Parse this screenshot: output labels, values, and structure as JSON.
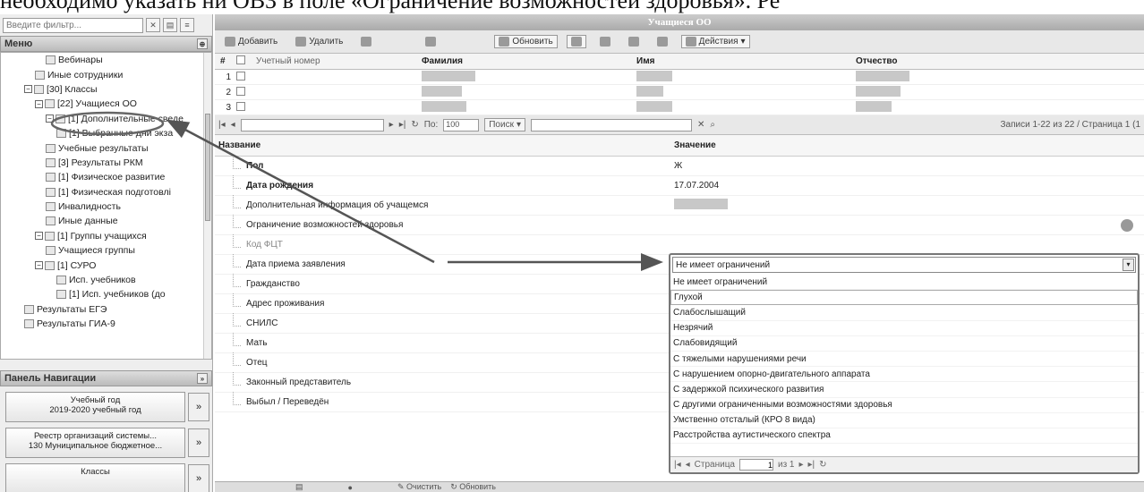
{
  "doc_text": "необходимо указать ни ОВЗ в поле «Ограничение возможностей здоровья». Ре",
  "left": {
    "filter_placeholder": "Введите фильтр...",
    "menu_title": "Меню",
    "tree_items": [
      {
        "label": "Вебинары",
        "indent": 4,
        "exp": ""
      },
      {
        "label": "Иные сотрудники",
        "indent": 3,
        "exp": ""
      },
      {
        "label": "[30] Классы",
        "indent": 2,
        "exp": "−"
      },
      {
        "label": "[22] Учащиеся ОО",
        "indent": 3,
        "exp": "−"
      },
      {
        "label": "[1] Дополнительные сведе",
        "indent": 4,
        "exp": "−"
      },
      {
        "label": "[1] Выбранные дни экза",
        "indent": 5,
        "exp": ""
      },
      {
        "label": "Учебные результаты",
        "indent": 4,
        "exp": ""
      },
      {
        "label": "[3] Результаты РКМ",
        "indent": 4,
        "exp": ""
      },
      {
        "label": "[1] Физическое развитие",
        "indent": 4,
        "exp": ""
      },
      {
        "label": "[1] Физическая подготовлі",
        "indent": 4,
        "exp": ""
      },
      {
        "label": "Инвалидность",
        "indent": 4,
        "exp": ""
      },
      {
        "label": "Иные данные",
        "indent": 4,
        "exp": ""
      },
      {
        "label": "[1] Группы учащихся",
        "indent": 3,
        "exp": "−"
      },
      {
        "label": "Учащиеся группы",
        "indent": 4,
        "exp": ""
      },
      {
        "label": "[1] СУРО",
        "indent": 3,
        "exp": "−"
      },
      {
        "label": "Исп. учебников",
        "indent": 5,
        "exp": ""
      },
      {
        "label": "[1] Исп. учебников (до",
        "indent": 5,
        "exp": ""
      },
      {
        "label": "Результаты ЕГЭ",
        "indent": 2,
        "exp": ""
      },
      {
        "label": "Результаты ГИА-9",
        "indent": 2,
        "exp": ""
      }
    ],
    "nav_title": "Панель Навигации",
    "nav_cards": [
      {
        "line1": "Учебный год",
        "line2": "2019-2020 учебный год"
      },
      {
        "line1": "Реестр организаций системы...",
        "line2": "130 Муниципальное бюджетное..."
      },
      {
        "line1": "Классы",
        "line2": ""
      }
    ]
  },
  "right": {
    "window_title": "Учащиеся ОО",
    "toolbar": {
      "add": "Добавить",
      "delete": "Удалить",
      "refresh": "Обновить",
      "actions": "Действия"
    },
    "grid": {
      "headers": {
        "hash": "#",
        "account": "Учетный номер",
        "surname": "Фамилия",
        "name": "Имя",
        "patronymic": "Отчество"
      },
      "row_numbers": [
        "1",
        "2",
        "3"
      ]
    },
    "pager": {
      "page_size_label": "По:",
      "page_size": "100",
      "search": "Поиск",
      "records": "Записи 1-22 из 22 / Страница 1 (1"
    },
    "props": {
      "header_name": "Название",
      "header_value": "Значение",
      "rows": [
        {
          "name": "Пол",
          "value": "Ж",
          "style": "bold"
        },
        {
          "name": "Дата рождения",
          "value": "17.07.2004",
          "style": "bold"
        },
        {
          "name": "Дополнительная информация об учащемся",
          "value": "",
          "style": ""
        },
        {
          "name": "Ограничение возможностей здоровья",
          "value": "",
          "style": ""
        },
        {
          "name": "Код ФЦТ",
          "value": "",
          "style": "gray"
        },
        {
          "name": "Дата приема заявления",
          "value": "",
          "style": ""
        },
        {
          "name": "Гражданство",
          "value": "",
          "style": ""
        },
        {
          "name": "Адрес проживания",
          "value": "",
          "style": ""
        },
        {
          "name": "СНИЛС",
          "value": "",
          "style": ""
        },
        {
          "name": "Мать",
          "value": "",
          "style": ""
        },
        {
          "name": "Отец",
          "value": "",
          "style": ""
        },
        {
          "name": "Законный представитель",
          "value": "",
          "style": ""
        },
        {
          "name": "Выбыл / Переведён",
          "value": "",
          "style": ""
        }
      ]
    },
    "footer": {
      "clear": "Очистить",
      "refresh": "Обновить"
    }
  },
  "dropdown": {
    "selected": "Не имеет ограничений",
    "options": [
      "Не имеет ограничений",
      "Глухой",
      "Слабослышащий",
      "Незрячий",
      "Слабовидящий",
      "С тяжелыми нарушениями речи",
      "С нарушением опорно-двигательного аппарата",
      "С задержкой психического развития",
      "С другими ограниченными возможностями здоровья",
      "Умственно отсталый (КРО 8 вида)",
      "Расстройства аутистического спектра"
    ],
    "page_label": "Страница",
    "page_value": "1",
    "page_of": "из 1"
  }
}
